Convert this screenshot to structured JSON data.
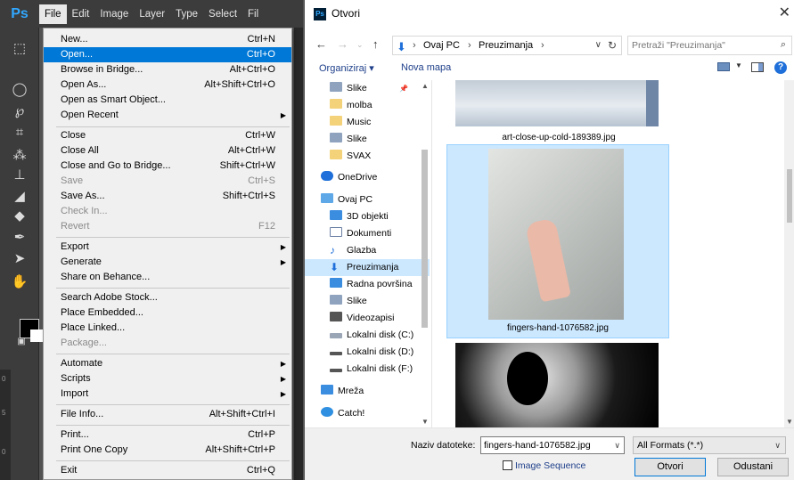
{
  "photoshop": {
    "logo": "Ps",
    "menubar": [
      "File",
      "Edit",
      "Image",
      "Layer",
      "Type",
      "Select",
      "Fil"
    ],
    "ruler_marks": [
      "0",
      "5",
      "0"
    ]
  },
  "file_menu": {
    "items": [
      {
        "label": "New...",
        "shortcut": "Ctrl+N"
      },
      {
        "label": "Open...",
        "shortcut": "Ctrl+O"
      },
      {
        "label": "Browse in Bridge...",
        "shortcut": "Alt+Ctrl+O"
      },
      {
        "label": "Open As...",
        "shortcut": "Alt+Shift+Ctrl+O"
      },
      {
        "label": "Open as Smart Object...",
        "shortcut": ""
      },
      {
        "label": "Open Recent",
        "shortcut": ""
      },
      {
        "label": "Close",
        "shortcut": "Ctrl+W"
      },
      {
        "label": "Close All",
        "shortcut": "Alt+Ctrl+W"
      },
      {
        "label": "Close and Go to Bridge...",
        "shortcut": "Shift+Ctrl+W"
      },
      {
        "label": "Save",
        "shortcut": "Ctrl+S"
      },
      {
        "label": "Save As...",
        "shortcut": "Shift+Ctrl+S"
      },
      {
        "label": "Check In...",
        "shortcut": ""
      },
      {
        "label": "Revert",
        "shortcut": "F12"
      },
      {
        "label": "Export",
        "shortcut": ""
      },
      {
        "label": "Generate",
        "shortcut": ""
      },
      {
        "label": "Share on Behance...",
        "shortcut": ""
      },
      {
        "label": "Search Adobe Stock...",
        "shortcut": ""
      },
      {
        "label": "Place Embedded...",
        "shortcut": ""
      },
      {
        "label": "Place Linked...",
        "shortcut": ""
      },
      {
        "label": "Package...",
        "shortcut": ""
      },
      {
        "label": "Automate",
        "shortcut": ""
      },
      {
        "label": "Scripts",
        "shortcut": ""
      },
      {
        "label": "Import",
        "shortcut": ""
      },
      {
        "label": "File Info...",
        "shortcut": "Alt+Shift+Ctrl+I"
      },
      {
        "label": "Print...",
        "shortcut": "Ctrl+P"
      },
      {
        "label": "Print One Copy",
        "shortcut": "Alt+Shift+Ctrl+P"
      },
      {
        "label": "Exit",
        "shortcut": "Ctrl+Q"
      }
    ]
  },
  "dialog": {
    "title": "Otvori",
    "app_badge": "Ps",
    "close_glyph": "✕",
    "address": [
      "Ovaj PC",
      "Preuzimanja"
    ],
    "search_placeholder": "Pretraži \"Preuzimanja\"",
    "organize": "Organiziraj ▾",
    "new_folder": "Nova mapa",
    "nav_items": [
      "Slike",
      "molba",
      "Music",
      "Slike",
      "SVAX",
      "OneDrive",
      "Ovaj PC",
      "3D objekti",
      "Dokumenti",
      "Glazba",
      "Preuzimanja",
      "Radna površina",
      "Slike",
      "Videozapisi",
      "Lokalni disk (C:)",
      "Lokalni disk (D:)",
      "Lokalni disk (F:)",
      "Mreža",
      "Catch!"
    ],
    "files": [
      "art-close-up-cold-189389.jpg",
      "fingers-hand-1076582.jpg"
    ],
    "filename_label": "Naziv datoteke:",
    "filename_value": "fingers-hand-1076582.jpg",
    "format_value": "All Formats (*.*)",
    "image_sequence": "Image Sequence",
    "open_button": "Otvori",
    "cancel_button": "Odustani"
  },
  "colors": {
    "accent": "#0078d7",
    "selection": "#cce8ff",
    "ps_blue": "#31a8ff"
  }
}
